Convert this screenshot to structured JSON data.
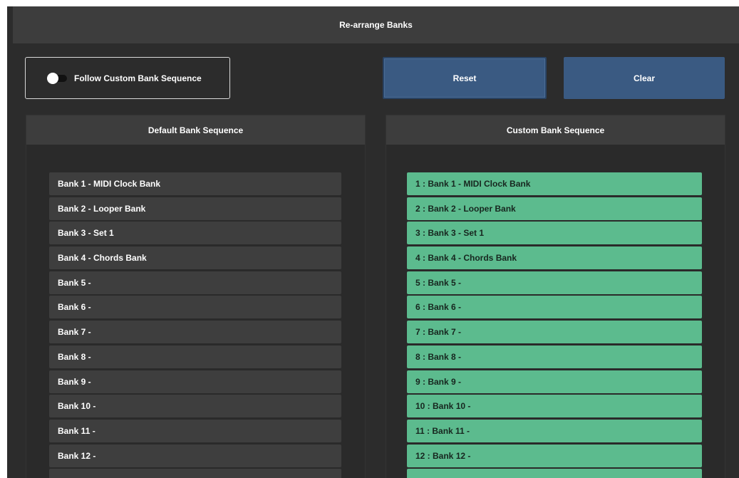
{
  "title": "Re-arrange Banks",
  "toggle": {
    "label": "Follow Custom Bank Sequence",
    "state": "off"
  },
  "buttons": {
    "reset": "Reset",
    "clear": "Clear"
  },
  "colors": {
    "window_bg": "#2c2c2c",
    "button_bg": "#3a5a82",
    "custom_row_bg": "#5cbb8e",
    "default_row_bg": "#3e3e3e"
  },
  "default_sequence": {
    "header": "Default Bank Sequence",
    "items": [
      "Bank 1 - MIDI Clock Bank",
      "Bank 2 - Looper Bank",
      "Bank 3 - Set 1",
      "Bank 4 - Chords Bank",
      "Bank 5 -",
      "Bank 6 -",
      "Bank 7 -",
      "Bank 8 -",
      "Bank 9 -",
      "Bank 10 -",
      "Bank 11 -",
      "Bank 12 -"
    ]
  },
  "custom_sequence": {
    "header": "Custom Bank Sequence",
    "items": [
      "1 : Bank 1 - MIDI Clock Bank",
      "2 : Bank 2 - Looper Bank",
      "3 : Bank 3 - Set 1",
      "4 : Bank 4 - Chords Bank",
      "5 : Bank 5 -",
      "6 : Bank 6 -",
      "7 : Bank 7 -",
      "8 : Bank 8 -",
      "9 : Bank 9 -",
      "10 : Bank 10 -",
      "11 : Bank 11 -",
      "12 : Bank 12 -"
    ]
  }
}
